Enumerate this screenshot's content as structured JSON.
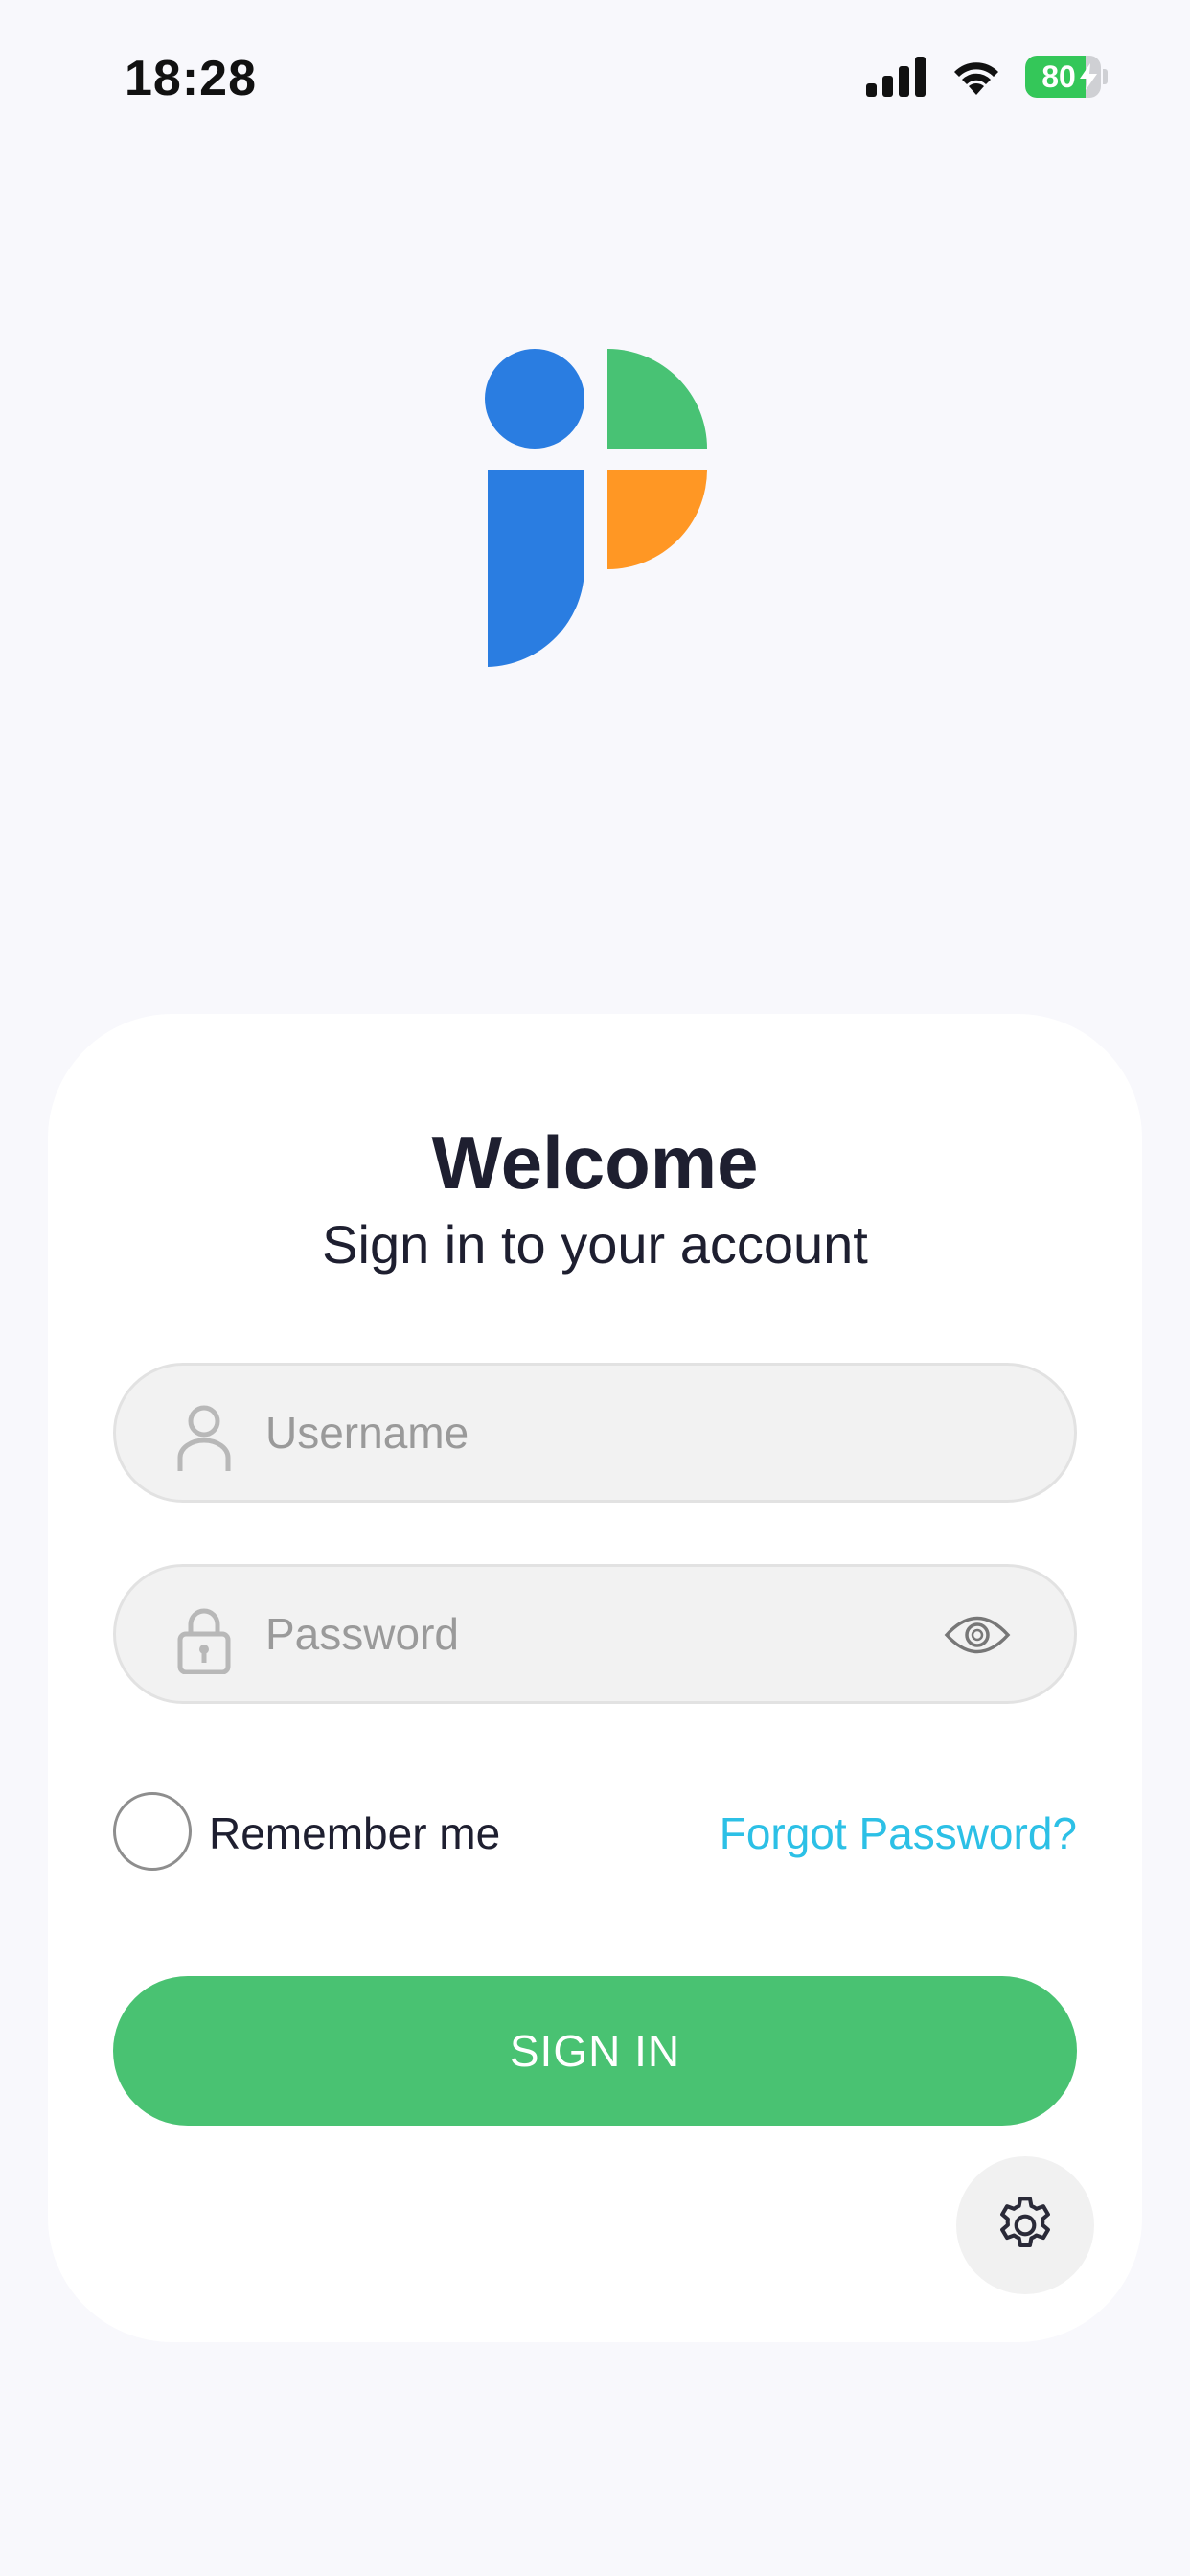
{
  "status_bar": {
    "time": "18:28",
    "battery_level": "80",
    "battery_percent": 80
  },
  "card": {
    "title": "Welcome",
    "subtitle": "Sign in to your account"
  },
  "form": {
    "username_placeholder": "Username",
    "username_value": "",
    "password_placeholder": "Password",
    "password_value": "",
    "remember_label": "Remember me",
    "remember_checked": false,
    "forgot_label": "Forgot Password?",
    "submit_label": "SIGN IN"
  },
  "icons": {
    "username": "user-icon",
    "password": "lock-icon",
    "visibility": "eye-icon",
    "settings": "gear-icon"
  },
  "colors": {
    "brand_green": "#49c272",
    "logo_blue": "#2a7de1",
    "logo_green": "#48c274",
    "logo_orange": "#ff9724",
    "link": "#2cc0e6",
    "background": "#f8f8fc"
  }
}
